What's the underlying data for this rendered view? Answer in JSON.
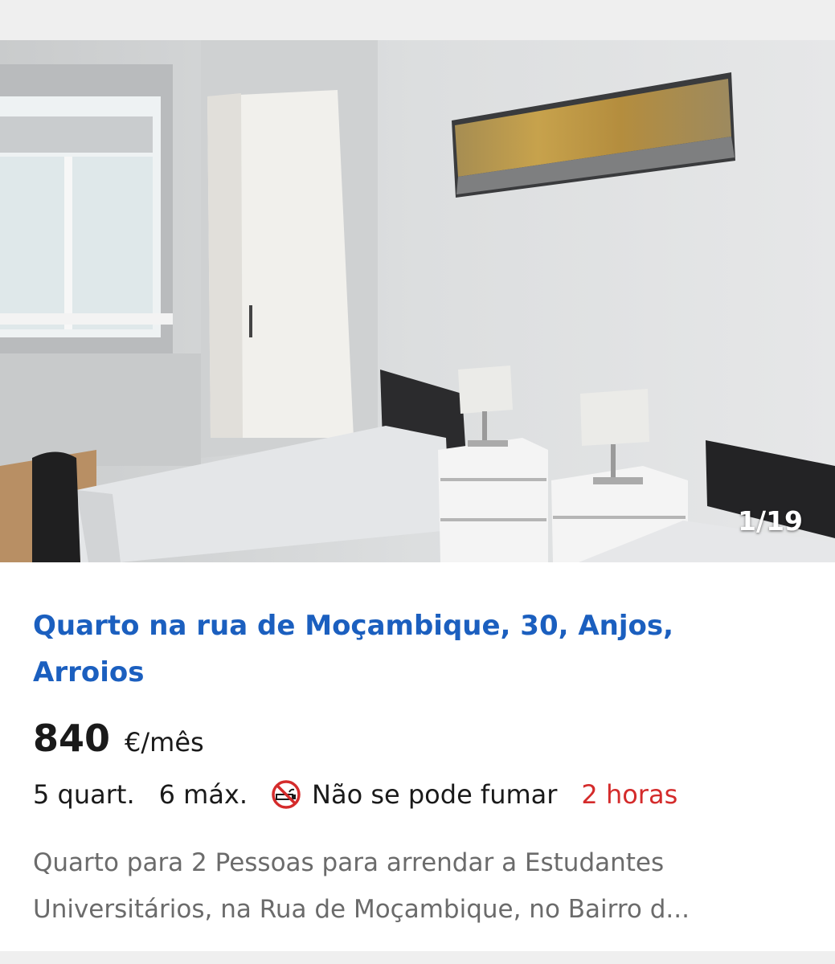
{
  "listing": {
    "photo_counter": "1/19",
    "title": "Quarto na rua de Moçambique, 30, Anjos, Arroios",
    "price": "840",
    "price_unit": "€/mês",
    "features": {
      "rooms": "5 quart.",
      "max": "6 máx.",
      "smoking_icon": "no-smoking-icon",
      "smoking": "Não se pode fumar",
      "posted": "2 horas"
    },
    "description_line1": "Quarto para 2 Pessoas para arrendar a Estudantes",
    "description_line2": "Universitários, na Rua de Moçambique, no Bairro d..."
  },
  "colors": {
    "title": "#1b5fbf",
    "posted": "#d42b2b",
    "description": "#6b6b6b"
  }
}
